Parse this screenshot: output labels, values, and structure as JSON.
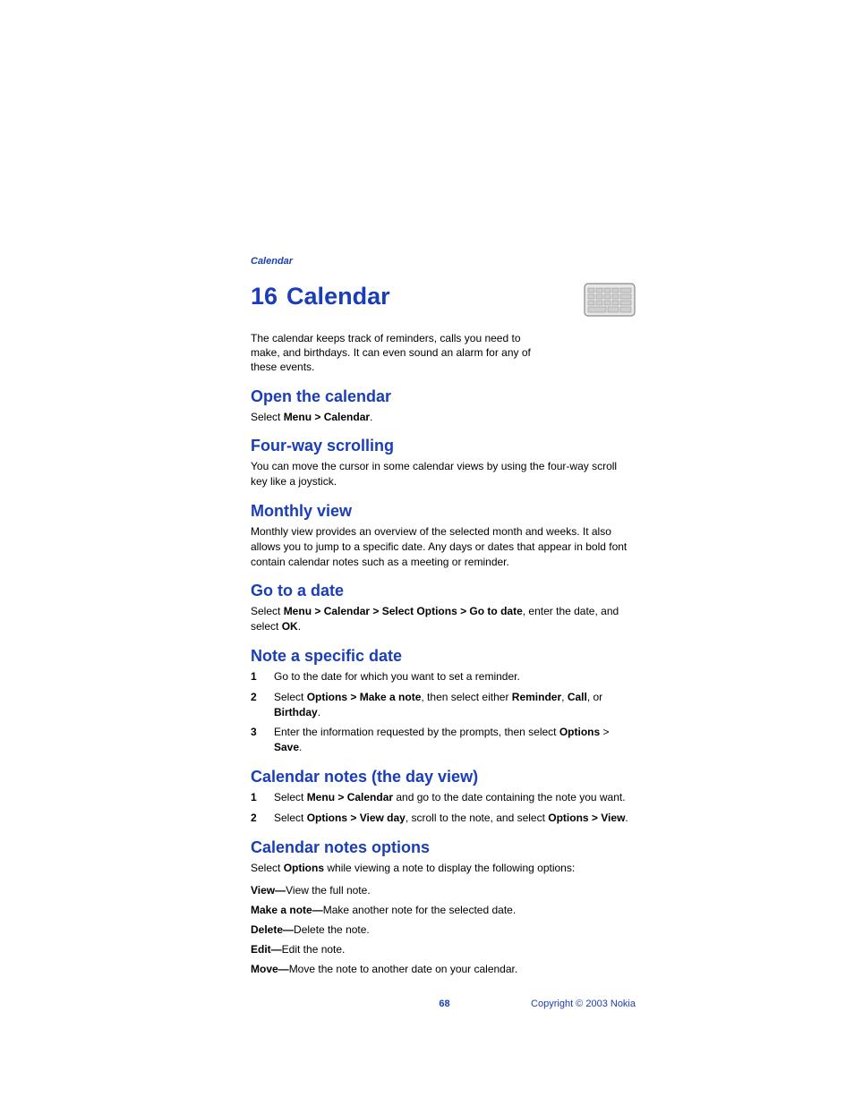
{
  "running_head": "Calendar",
  "chapter": {
    "number": "16",
    "title": "Calendar"
  },
  "intro": "The calendar keeps track of reminders, calls you need to make, and birthdays. It can even sound an alarm for any of these events.",
  "sections": {
    "open": {
      "heading": "Open the calendar",
      "prefix": "Select ",
      "bold": "Menu > Calendar",
      "suffix": "."
    },
    "scroll": {
      "heading": "Four-way scrolling",
      "body": "You can move the cursor in some calendar views by using the four-way scroll key like a joystick."
    },
    "monthly": {
      "heading": "Monthly view",
      "body": "Monthly view provides an overview of the selected month and weeks. It also allows you to jump to a specific date. Any days or dates that appear in bold font contain calendar notes such as a meeting or reminder."
    },
    "gotodate": {
      "heading": "Go to a date",
      "prefix": "Select ",
      "bold1": "Menu > Calendar > Select Options > Go to date",
      "mid": ", enter the date, and select ",
      "bold2": "OK",
      "suffix": "."
    },
    "note_date": {
      "heading": "Note a specific date",
      "steps": [
        {
          "n": "1",
          "text": "Go to the date for which you want to set a reminder."
        },
        {
          "n": "2",
          "pre": "Select ",
          "b1": "Options > Make a note",
          "mid1": ", then select either ",
          "b2": "Reminder",
          "mid2": ", ",
          "b3": "Call",
          "mid3": ", or ",
          "b4": "Birthday",
          "end": "."
        },
        {
          "n": "3",
          "pre": "Enter the information requested by the prompts, then select ",
          "b1": "Options",
          "mid1": " > ",
          "b2": "Save",
          "end": "."
        }
      ]
    },
    "day_view": {
      "heading": "Calendar notes (the day view)",
      "steps": [
        {
          "n": "1",
          "pre": "Select ",
          "b1": "Menu > Calendar",
          "end": " and go to the date containing the note you want."
        },
        {
          "n": "2",
          "pre": "Select ",
          "b1": "Options > View day",
          "mid1": ", scroll to the note, and select ",
          "b2": "Options > View",
          "end": "."
        }
      ]
    },
    "options": {
      "heading": "Calendar notes options",
      "intro_pre": "Select ",
      "intro_bold": "Options",
      "intro_post": " while viewing a note to display the following options:",
      "items": [
        {
          "label": "View—",
          "desc": "View the full note."
        },
        {
          "label": "Make a note—",
          "desc": "Make another note for the selected date."
        },
        {
          "label": "Delete—",
          "desc": "Delete the note."
        },
        {
          "label": "Edit—",
          "desc": "Edit the note."
        },
        {
          "label": "Move—",
          "desc": "Move the note to another date on your calendar."
        }
      ]
    }
  },
  "footer": {
    "page": "68",
    "copyright": "Copyright © 2003 Nokia"
  }
}
